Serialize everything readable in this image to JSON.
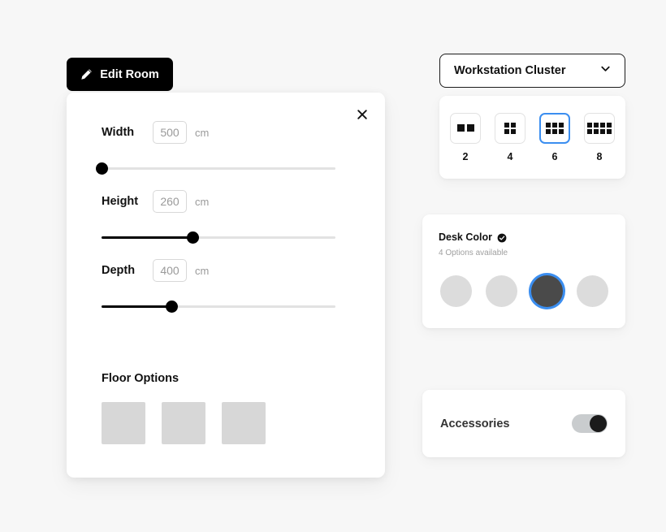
{
  "theme": {
    "page_background": "#f7f7f7",
    "accent": "#3b8ef0",
    "primary": "#000000",
    "swatch_light": "#dcdcdc",
    "swatch_dark": "#4a4a4a",
    "floor_swatch": "#d7d7d7"
  },
  "edit_room_button": {
    "label": "Edit Room",
    "icon": "pencil-icon"
  },
  "editor": {
    "close_icon": "close-icon",
    "fields": [
      {
        "label": "Width",
        "value": "500",
        "placeholder": "500",
        "unit": "cm",
        "slider_percent": 0
      },
      {
        "label": "Height",
        "value": "260",
        "placeholder": "260",
        "unit": "cm",
        "slider_percent": 39
      },
      {
        "label": "Depth",
        "value": "400",
        "placeholder": "400",
        "unit": "cm",
        "slider_percent": 30
      }
    ],
    "floor": {
      "title": "Floor Options",
      "swatches": [
        {
          "name": "floor-swatch-1",
          "color": "#d7d7d7"
        },
        {
          "name": "floor-swatch-2",
          "color": "#d7d7d7"
        },
        {
          "name": "floor-swatch-3",
          "color": "#d7d7d7"
        }
      ]
    }
  },
  "cluster": {
    "selected_label": "Workstation Cluster",
    "chevron_icon": "chevron-down-icon",
    "options": [
      {
        "count": "2",
        "rows": 1,
        "cols": 2,
        "selected": false
      },
      {
        "count": "4",
        "rows": 2,
        "cols": 2,
        "selected": false
      },
      {
        "count": "6",
        "rows": 2,
        "cols": 3,
        "selected": true
      },
      {
        "count": "8",
        "rows": 2,
        "cols": 4,
        "selected": false
      }
    ]
  },
  "desk_color": {
    "title": "Desk Color",
    "badge_icon": "check-circle-icon",
    "subtitle": "4 Options available",
    "swatches": [
      {
        "name": "desk-color-1",
        "color": "#dcdcdc",
        "selected": false
      },
      {
        "name": "desk-color-2",
        "color": "#dcdcdc",
        "selected": false
      },
      {
        "name": "desk-color-3",
        "color": "#4a4a4a",
        "selected": true
      },
      {
        "name": "desk-color-4",
        "color": "#dcdcdc",
        "selected": false
      }
    ]
  },
  "accessories": {
    "label": "Accessories",
    "enabled": true
  }
}
